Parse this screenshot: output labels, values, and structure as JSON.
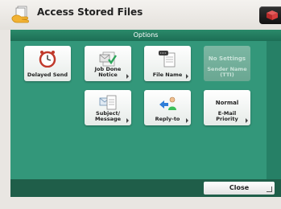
{
  "header": {
    "title": "Access Stored Files",
    "app_icon": "hand-document-icon",
    "right_icon": "cube-icon"
  },
  "options_bar": {
    "label": "Options"
  },
  "buttons": {
    "delayed_send": {
      "label": "Delayed Send",
      "icon": "clock-icon"
    },
    "job_done_notice": {
      "label": "Job Done\nNotice",
      "icon": "job-done-notice-icon"
    },
    "file_name": {
      "label": "File Name",
      "icon": "file-name-icon"
    },
    "sender_name": {
      "value": "No Settings",
      "label": "Sender Name\n(TTI)",
      "disabled": true
    },
    "subject_message": {
      "label": "Subject/\nMessage",
      "icon": "subject-message-icon"
    },
    "reply_to": {
      "label": "Reply-to",
      "icon": "reply-to-icon"
    },
    "email_priority": {
      "value": "Normal",
      "label": "E-Mail\nPriority"
    }
  },
  "footer": {
    "close_label": "Close"
  },
  "colors": {
    "panel": "#33977a",
    "options_bar": "#1d6e55",
    "footer": "#1f5e49"
  }
}
